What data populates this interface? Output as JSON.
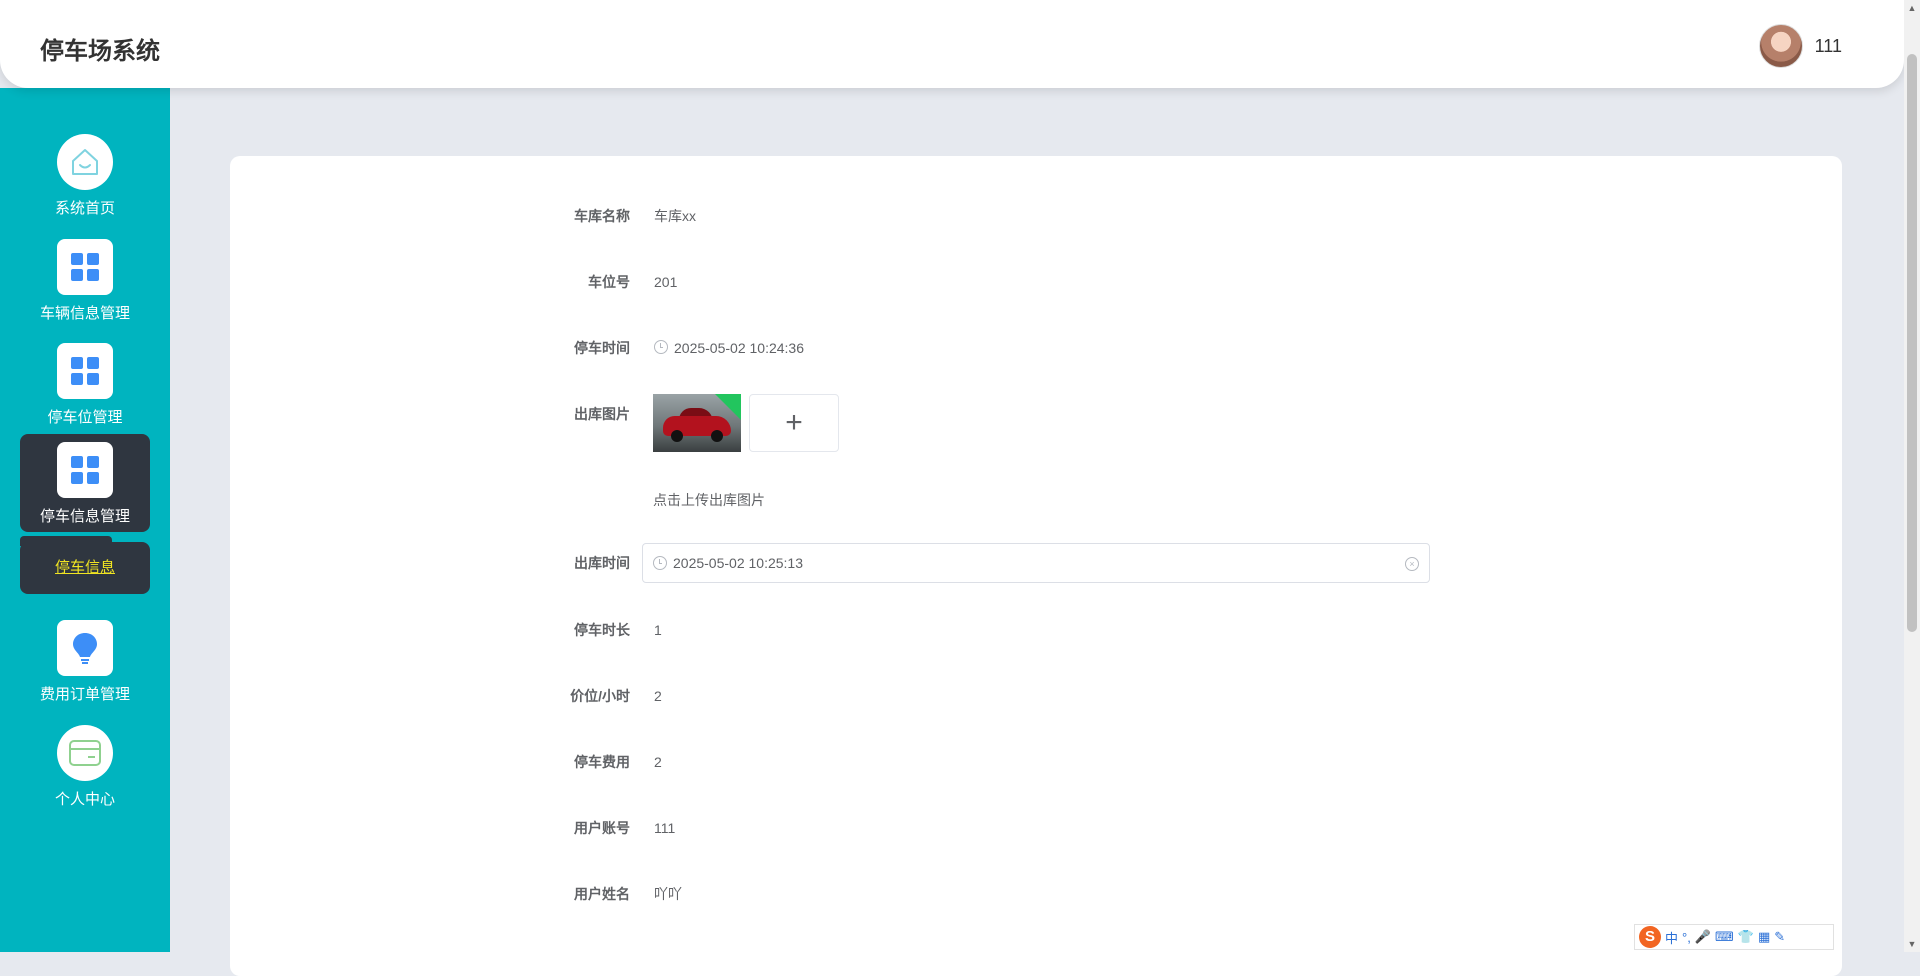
{
  "header": {
    "app_title": "停车场系统",
    "username": "111"
  },
  "sidebar": {
    "items": [
      {
        "label": "系统首页",
        "icon": "home-icon"
      },
      {
        "label": "车辆信息管理",
        "icon": "grid-icon"
      },
      {
        "label": "停车位管理",
        "icon": "grid-icon"
      },
      {
        "label": "停车信息管理",
        "icon": "grid-icon",
        "active": true
      },
      {
        "label": "费用订单管理",
        "icon": "bulb-icon"
      },
      {
        "label": "个人中心",
        "icon": "card-icon"
      }
    ],
    "submenu": {
      "label": "停车信息"
    }
  },
  "form": {
    "garage_name": {
      "label": "车库名称",
      "value": "车库xx"
    },
    "space_no": {
      "label": "车位号",
      "value": "201"
    },
    "park_time": {
      "label": "停车时间",
      "value": "2025-05-02 10:24:36"
    },
    "exit_image": {
      "label": "出库图片",
      "hint": "点击上传出库图片",
      "upload_symbol": "+"
    },
    "exit_time": {
      "label": "出库时间",
      "value": "2025-05-02 10:25:13"
    },
    "duration": {
      "label": "停车时长",
      "value": "1"
    },
    "price_per_hour": {
      "label": "价位/小时",
      "value": "2"
    },
    "fee": {
      "label": "停车费用",
      "value": "2"
    },
    "user_account": {
      "label": "用户账号",
      "value": "111"
    },
    "user_name": {
      "label": "用户姓名",
      "value": "吖吖"
    }
  },
  "ime_toolbar": {
    "logo": "S",
    "mode": "中"
  },
  "colors": {
    "sidebar_bg": "#00b4bf",
    "active_bg": "#2f3640",
    "submenu_text": "#f0e422",
    "icon_blue": "#3d8ef7"
  }
}
